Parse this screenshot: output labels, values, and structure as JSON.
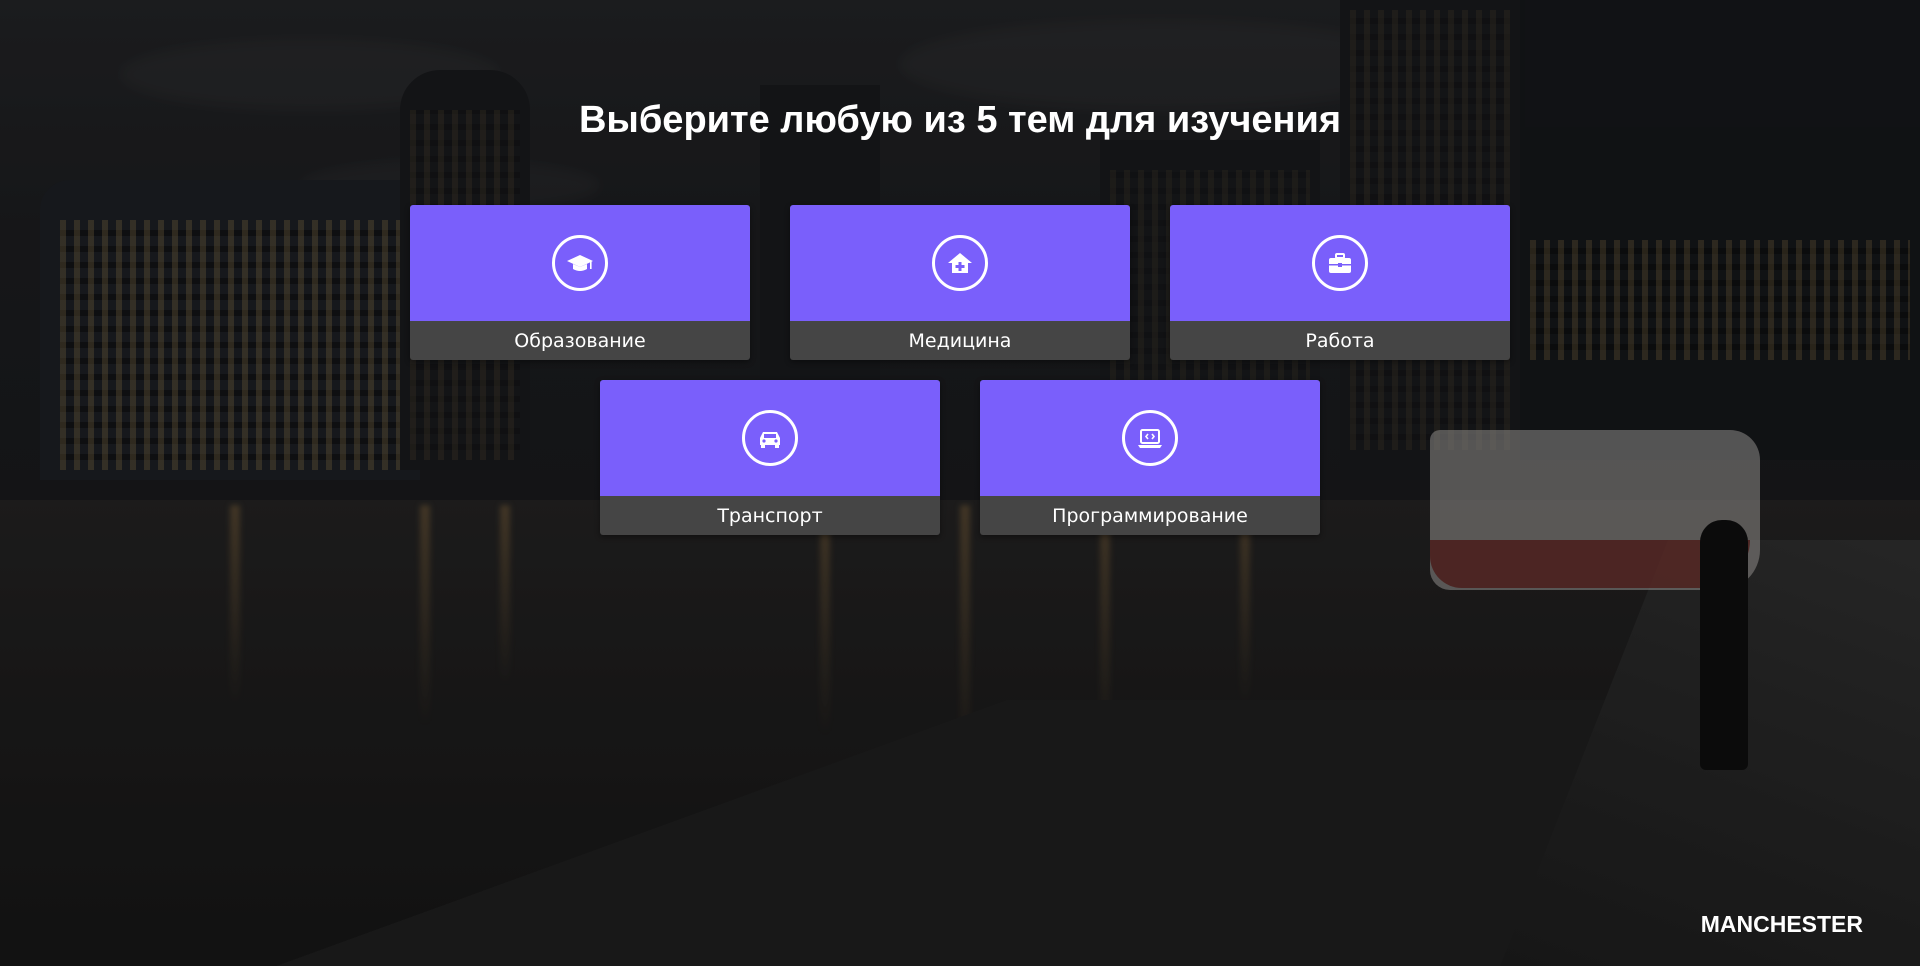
{
  "page": {
    "title": "Выберите любую из 5 тем для изучения",
    "brand": "MANCHESTER"
  },
  "topics": [
    {
      "label": "Образование",
      "icon": "graduation-cap-icon"
    },
    {
      "label": "Медицина",
      "icon": "medical-house-icon"
    },
    {
      "label": "Работа",
      "icon": "briefcase-icon"
    },
    {
      "label": "Транспорт",
      "icon": "car-icon"
    },
    {
      "label": "Программирование",
      "icon": "laptop-code-icon"
    }
  ],
  "colors": {
    "card_accent": "#7a5ffb",
    "card_label_bg": "#454545",
    "text": "#ffffff"
  }
}
